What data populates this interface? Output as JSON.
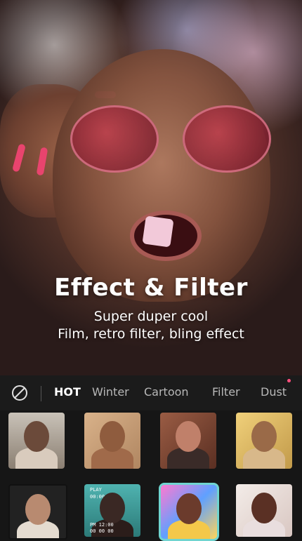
{
  "hero": {
    "title": "Effect & Filter",
    "subtitle_line1": "Super duper cool",
    "subtitle_line2": "Film, retro filter, bling effect"
  },
  "tabs": {
    "items": [
      {
        "label": "HOT",
        "active": true
      },
      {
        "label": "Winter",
        "active": false
      },
      {
        "label": "Cartoon",
        "active": false
      },
      {
        "label": "Filter",
        "active": false
      },
      {
        "label": "Dust",
        "active": false
      }
    ],
    "none_icon": "no-filter-icon",
    "indicator_color": "#ff4f7d"
  },
  "thumbnails": {
    "t6_label1": "PLAY",
    "t6_label2": "00:00:00",
    "t6_label3": "PM 12:00",
    "t6_label4": "00 00 00"
  },
  "colors": {
    "background": "#161616",
    "selected_border": "#6fd4d0"
  }
}
